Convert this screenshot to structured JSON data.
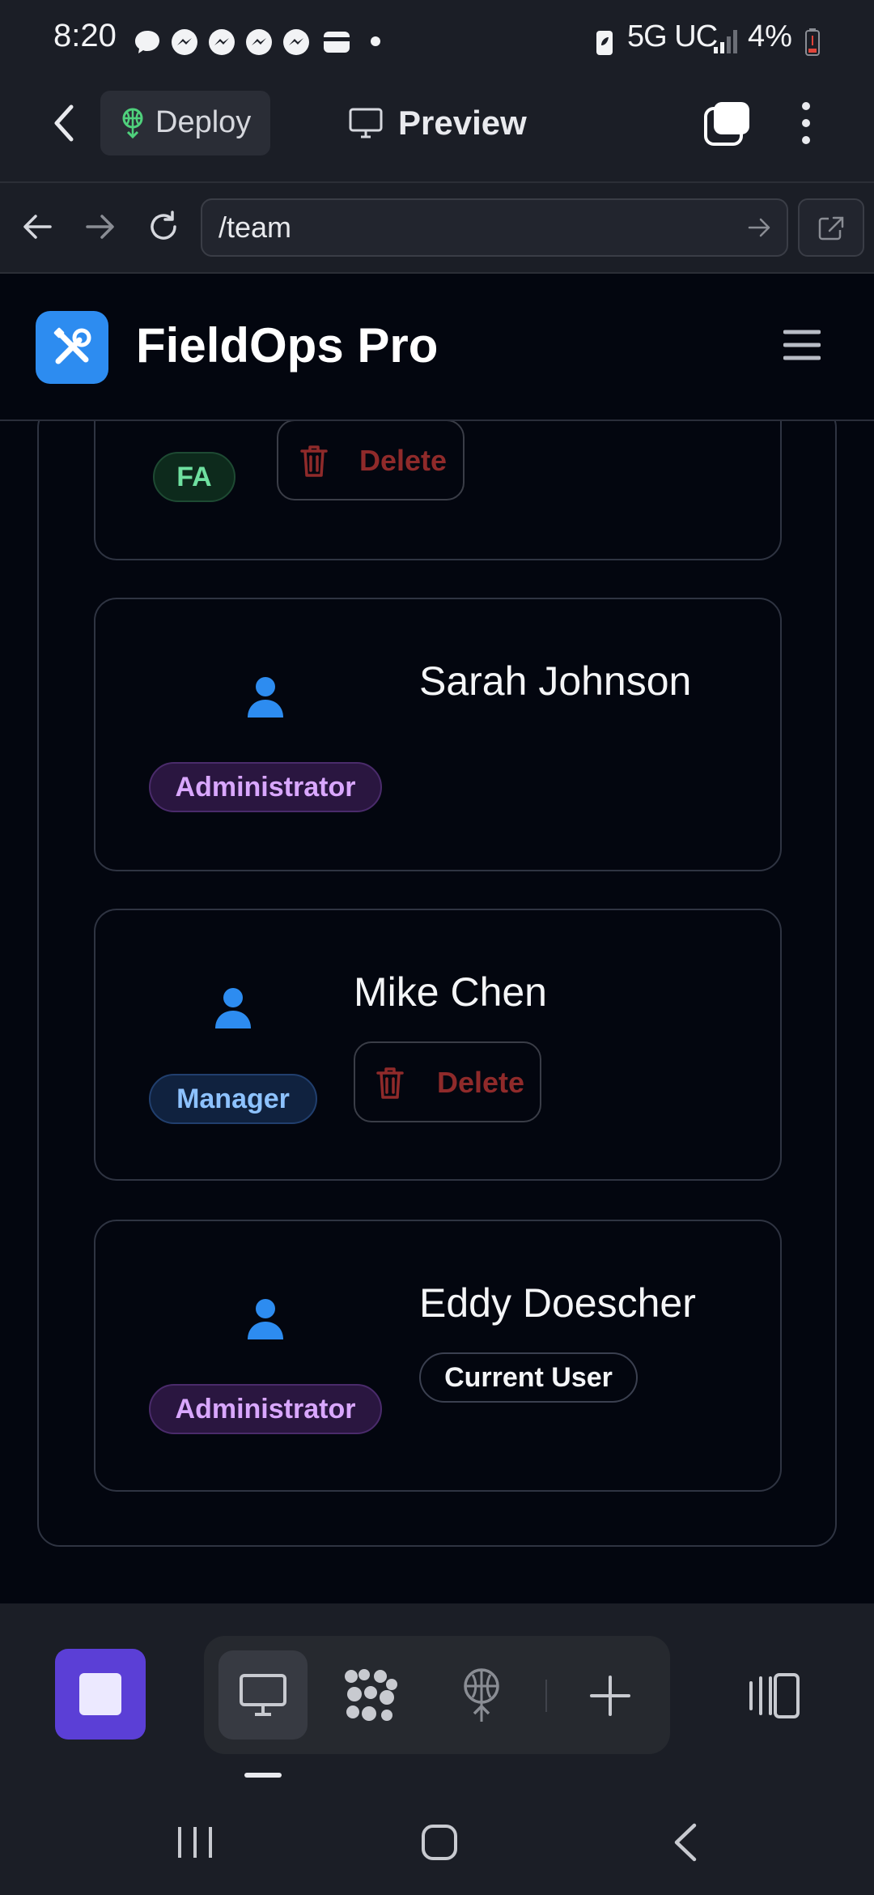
{
  "status_bar": {
    "time": "8:20",
    "network": "5G UC",
    "battery": "4%",
    "notification_icons": [
      "chat-bubble-icon",
      "messenger-icon",
      "messenger-icon",
      "messenger-icon",
      "messenger-icon",
      "wallet-icon",
      "dot-icon"
    ]
  },
  "top_bar": {
    "deploy_label": "Deploy",
    "preview_label": "Preview"
  },
  "url_bar": {
    "url": "/team"
  },
  "app": {
    "title": "FieldOps Pro",
    "accent_color": "#2d8cf0"
  },
  "team_cards": [
    {
      "name": "",
      "role_badge": "FA",
      "action": "Delete"
    },
    {
      "name": "Sarah Johnson",
      "role_badge": "Administrator"
    },
    {
      "name": "Mike Chen",
      "role_badge": "Manager",
      "action": "Delete"
    },
    {
      "name": "Eddy Doescher",
      "role_badge": "Administrator",
      "status_badge": "Current User"
    }
  ],
  "bottom_bar": {
    "tabs": [
      "monitor-icon",
      "apps-icon",
      "deploy-icon",
      "plus-icon"
    ],
    "active_tab": "monitor-icon"
  }
}
